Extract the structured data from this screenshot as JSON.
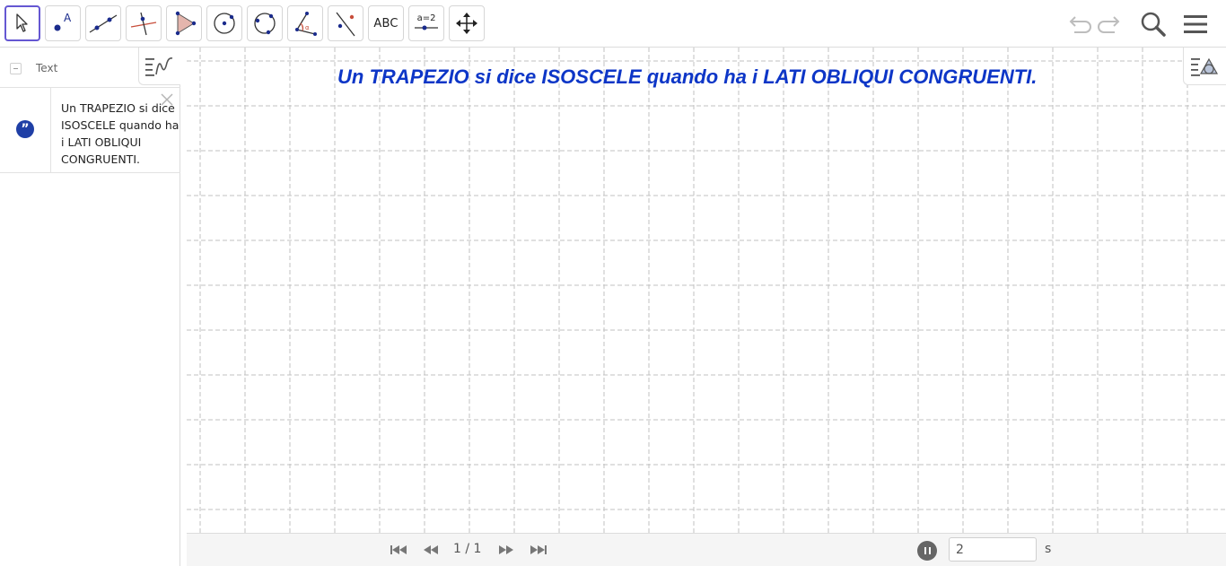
{
  "toolbar": {
    "tools": [
      {
        "name": "move-tool",
        "label": ""
      },
      {
        "name": "point-tool",
        "label": ""
      },
      {
        "name": "line-tool",
        "label": ""
      },
      {
        "name": "perpendicular-line-tool",
        "label": ""
      },
      {
        "name": "polygon-tool",
        "label": ""
      },
      {
        "name": "circle-center-point-tool",
        "label": ""
      },
      {
        "name": "circle-three-points-tool",
        "label": ""
      },
      {
        "name": "angle-tool",
        "label": ""
      },
      {
        "name": "reflect-tool",
        "label": ""
      },
      {
        "name": "text-tool",
        "label": "ABC"
      },
      {
        "name": "slider-tool",
        "label": "a=2"
      },
      {
        "name": "move-graphics-view-tool",
        "label": ""
      }
    ],
    "selected_tool": "move-tool",
    "icons": {
      "undo": "undo-icon",
      "redo": "redo-icon",
      "search": "search-icon",
      "menu": "menu-icon"
    },
    "accent_color": "#6557d2"
  },
  "algebra": {
    "header_label": "Text",
    "items": [
      {
        "icon": "quote-icon",
        "text": "Un TRAPEZIO si dice ISOSCELE quando ha i LATI OBLIQUI CONGRUENTI."
      }
    ]
  },
  "graphics": {
    "title": "Un TRAPEZIO si dice ISOSCELE quando ha i LATI OBLIQUI CONGRUENTI.",
    "title_color": "#0d36c7",
    "grid": true
  },
  "navigation": {
    "page_indicator": "1 / 1",
    "speed_value": "2",
    "speed_unit": "s"
  }
}
